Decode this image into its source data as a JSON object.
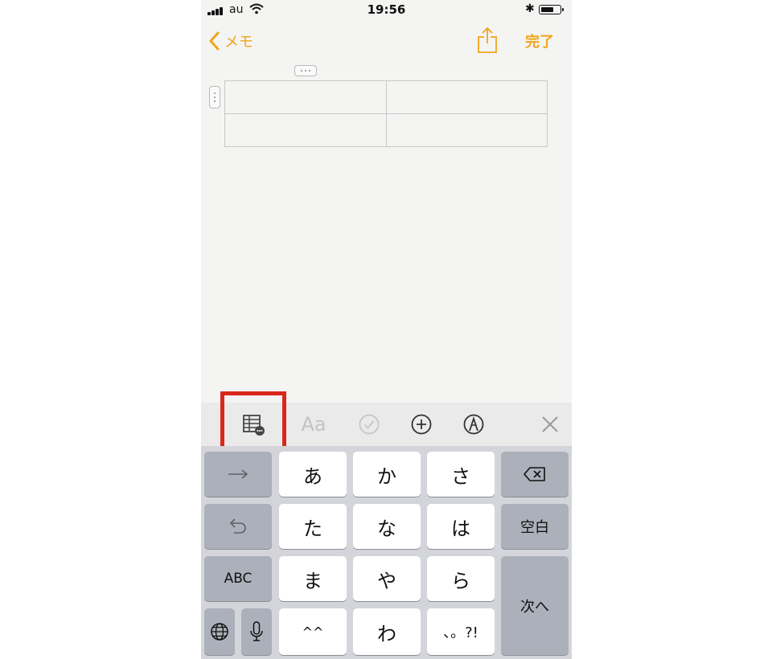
{
  "status_bar": {
    "carrier": "au",
    "time": "19:56"
  },
  "nav": {
    "back_label": "メモ",
    "done_label": "完了"
  },
  "toolbar": {
    "items": [
      "table-icon",
      "format-icon",
      "checklist-icon",
      "add-icon",
      "markup-icon",
      "close-keyboard-icon"
    ],
    "format_label": "Aa",
    "highlight_color": "#d9281c",
    "accent_color": "#f0a51b"
  },
  "keyboard": {
    "row1": [
      "あ",
      "か",
      "さ"
    ],
    "row2": [
      "た",
      "な",
      "は"
    ],
    "row3": [
      "ま",
      "や",
      "ら"
    ],
    "row4": [
      "^^",
      "わ",
      "、。?!"
    ],
    "abc_label": "ABC",
    "space_label": "空白",
    "next_label": "次へ"
  }
}
